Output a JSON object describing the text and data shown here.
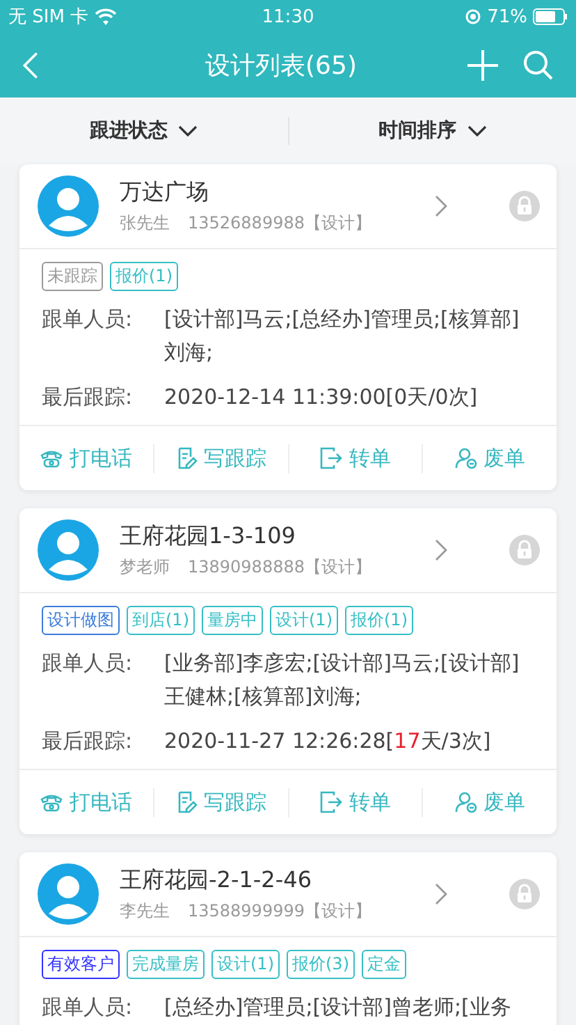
{
  "status_bar": {
    "carrier": "无 SIM 卡",
    "time": "11:30",
    "battery": "71%"
  },
  "nav": {
    "title": "设计列表(65)"
  },
  "filters": [
    {
      "label": "跟进状态"
    },
    {
      "label": "时间排序"
    }
  ],
  "cards": [
    {
      "title": "万达广场",
      "contact": "张先生",
      "phone": "13526889988【设计】",
      "tags": [
        {
          "label": "未跟踪",
          "color": "#9a9a9a"
        },
        {
          "label": "报价(1)",
          "color": "#36bfc6"
        }
      ],
      "staff_label": "跟单人员:",
      "staff": "[设计部]马云;[总经办]管理员;[核算部]刘海;",
      "last_label": "最后跟踪:",
      "last": [
        {
          "text": "2020-12-14 11:39:00[0天/0次]",
          "alert": false
        }
      ],
      "actions": [
        "打电话",
        "写跟踪",
        "转单",
        "废单"
      ]
    },
    {
      "title": "王府花园1-3-109",
      "contact": "梦老师",
      "phone": "13890988888【设计】",
      "tags": [
        {
          "label": "设计做图",
          "color": "#3b7ddb"
        },
        {
          "label": "到店(1)",
          "color": "#36bfc6"
        },
        {
          "label": "量房中",
          "color": "#36bfc6"
        },
        {
          "label": "设计(1)",
          "color": "#36bfc6"
        },
        {
          "label": "报价(1)",
          "color": "#36bfc6"
        }
      ],
      "staff_label": "跟单人员:",
      "staff": "[业务部]李彦宏;[设计部]马云;[设计部]王健林;[核算部]刘海;",
      "last_label": "最后跟踪:",
      "last": [
        {
          "text": "2020-11-27 12:26:28[",
          "alert": false
        },
        {
          "text": "17",
          "alert": true
        },
        {
          "text": "天/3次]",
          "alert": false
        }
      ],
      "actions": [
        "打电话",
        "写跟踪",
        "转单",
        "废单"
      ]
    },
    {
      "title": "王府花园-2-1-2-46",
      "contact": "李先生",
      "phone": "13588999999【设计】",
      "tags": [
        {
          "label": "有效客户",
          "color": "#3333ff"
        },
        {
          "label": "完成量房",
          "color": "#36bfc6"
        },
        {
          "label": "设计(1)",
          "color": "#36bfc6"
        },
        {
          "label": "报价(3)",
          "color": "#36bfc6"
        },
        {
          "label": "定金",
          "color": "#36bfc6"
        }
      ],
      "staff_label": "跟单人员:",
      "staff": "[总经办]管理员;[设计部]曾老师;[业务"
    }
  ]
}
